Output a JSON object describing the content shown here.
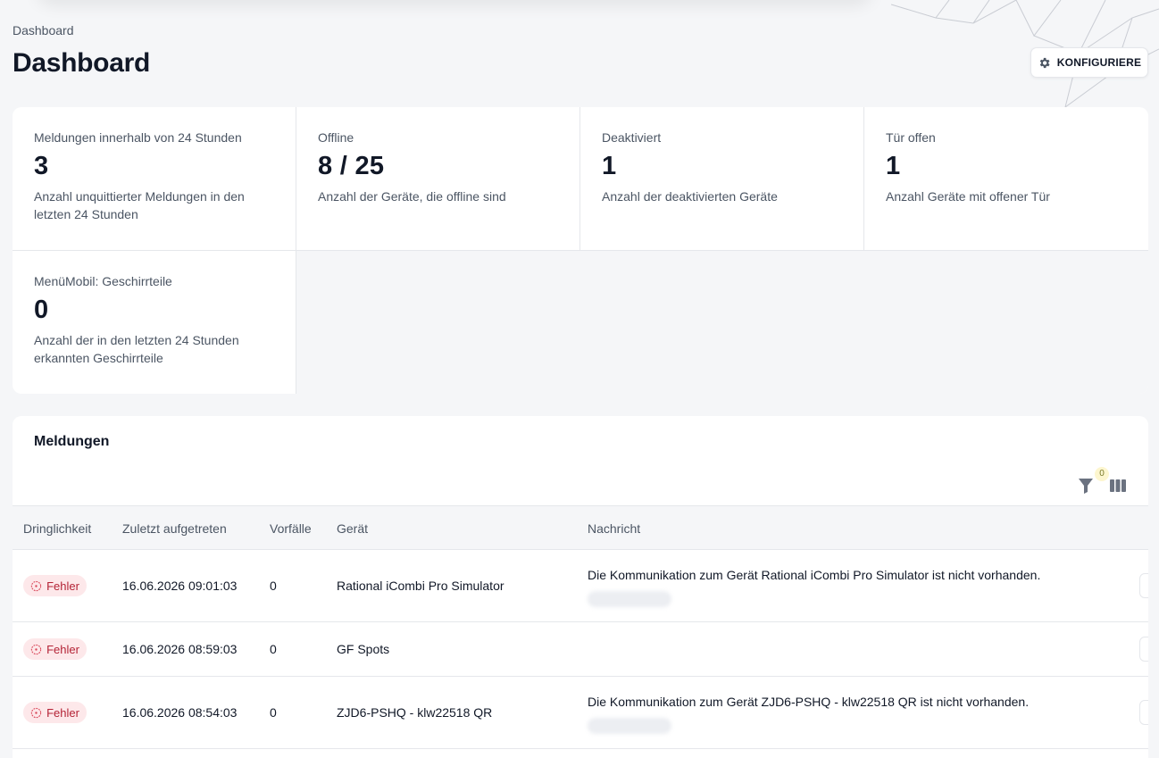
{
  "breadcrumb": "Dashboard",
  "title": "Dashboard",
  "configure_label": "KONFIGURIERE",
  "stats": [
    {
      "title": "Meldungen innerhalb von 24 Stunden",
      "value": "3",
      "desc": "Anzahl unquittierter Meldungen in den letzten 24 Stunden"
    },
    {
      "title": "Offline",
      "value": "8 / 25",
      "desc": "Anzahl der Geräte, die offline sind"
    },
    {
      "title": "Deaktiviert",
      "value": "1",
      "desc": "Anzahl der deaktivierten Geräte"
    },
    {
      "title": "Tür offen",
      "value": "1",
      "desc": "Anzahl Geräte mit offener Tür"
    },
    {
      "title": "MenüMobil: Geschirrteile",
      "value": "0",
      "desc": "Anzahl der in den letzten 24 Stunden erkannten Geschirrteile"
    }
  ],
  "messages": {
    "title": "Meldungen",
    "filter_count": "0",
    "columns": [
      "Dringlichkeit",
      "Zuletzt aufgetreten",
      "Vorfälle",
      "Gerät",
      "Nachricht"
    ],
    "rows": [
      {
        "severity": "Fehler",
        "time": "16.06.2026 09:01:03",
        "count": "0",
        "device": "Rational iCombi Pro Simulator",
        "message": "Die Kommunikation zum Gerät Rational iCombi Pro Simulator ist nicht vorhanden."
      },
      {
        "severity": "Fehler",
        "time": "16.06.2026 08:59:03",
        "count": "0",
        "device": "GF Spots",
        "message": ""
      },
      {
        "severity": "Fehler",
        "time": "16.06.2026 08:54:03",
        "count": "0",
        "device": "ZJD6-PSHQ - klw22518 QR",
        "message": "Die Kommunikation zum Gerät ZJD6-PSHQ - klw22518 QR ist nicht vorhanden."
      }
    ]
  },
  "colors": {
    "accent_error_bg": "#fde8ea",
    "accent_error_text": "#b42336",
    "page_bg": "#f5f6f8"
  }
}
